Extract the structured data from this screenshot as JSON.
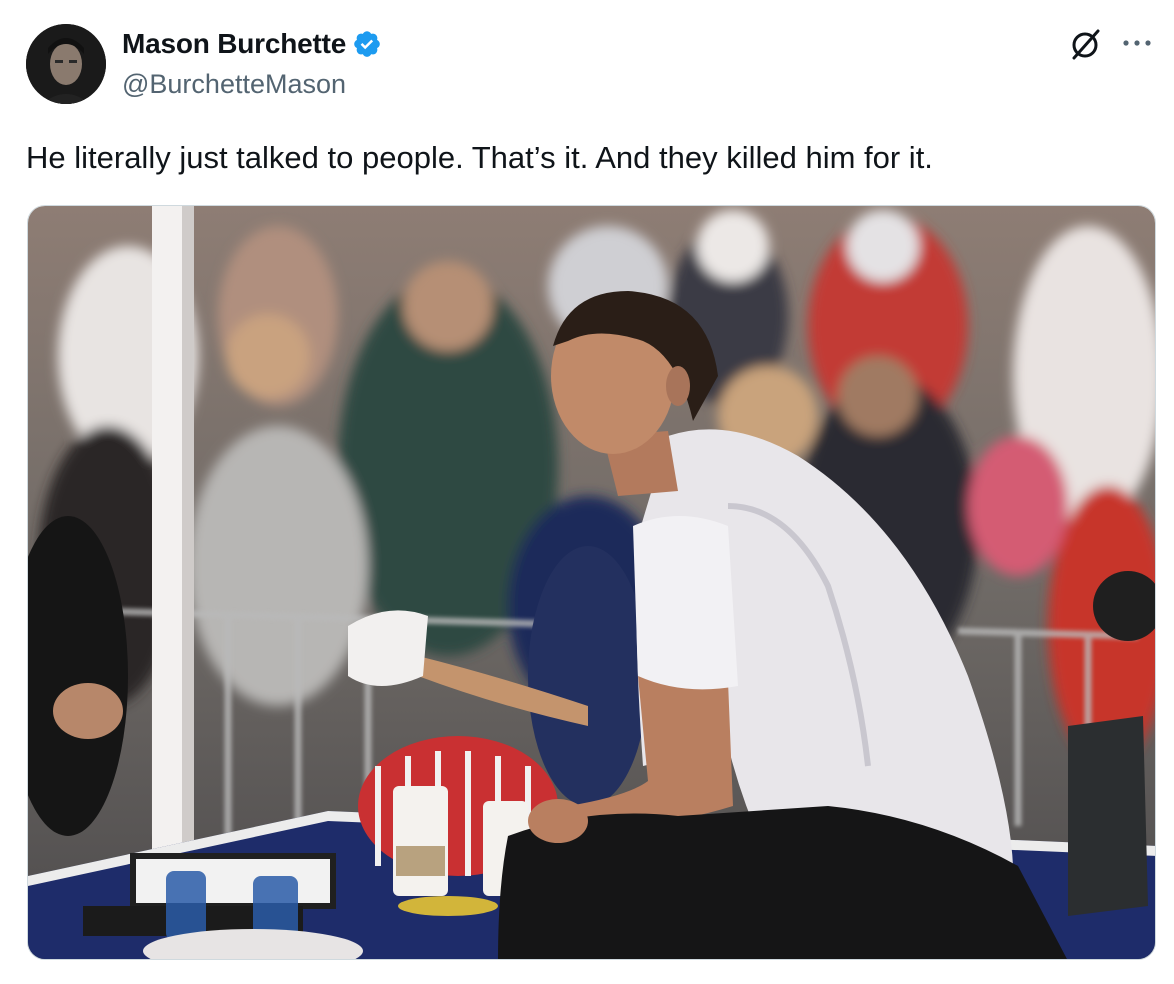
{
  "author": {
    "display_name": "Mason Burchette",
    "handle": "@BurchetteMason",
    "verified": true,
    "verified_color": "#1d9bf0"
  },
  "tweet": {
    "text": "He literally just talked to people. That’s it. And they killed him for it."
  },
  "icons": {
    "grok": "grok-icon",
    "more": "more-options-icon",
    "verified": "verified-badge-icon"
  },
  "media": {
    "kind": "photo",
    "subject": "man in white t-shirt seated at outdoor table before a crowd"
  }
}
